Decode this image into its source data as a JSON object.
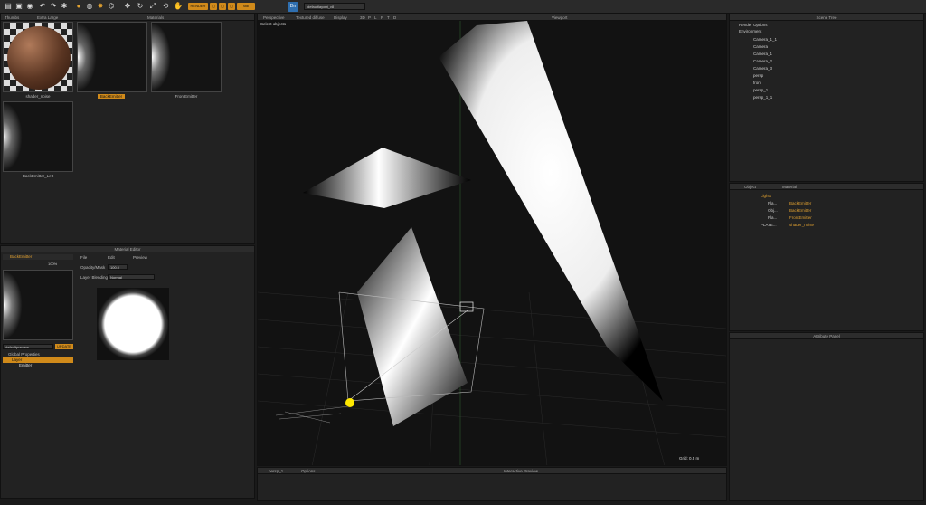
{
  "toolbar": {
    "fx_label": "RENDER",
    "mode_label": "Still",
    "app_badge": "Dn",
    "layout_value": "defaultlayout_v8",
    "icons": [
      "new-file-icon",
      "open-icon",
      "sphere-icon",
      "undo-icon",
      "redo-icon",
      "settings-icon",
      "render-icon",
      "material-icon",
      "light-icon",
      "camera-icon",
      "move-icon",
      "rotate-icon",
      "scale-icon",
      "orbit-icon",
      "pan-icon"
    ]
  },
  "thumbnails_panel": {
    "tabs": [
      "Thumbs",
      "Extra Large"
    ],
    "header": "Materials",
    "items": [
      {
        "label": "shader_noise",
        "selected": false
      },
      {
        "label": "BackEmitter",
        "selected": true
      },
      {
        "label": "FrontEmitter",
        "selected": false
      },
      {
        "label": "BackEmitter_Left",
        "selected": false
      }
    ]
  },
  "viewport": {
    "title": "Viewport",
    "tabs": [
      "Perspective",
      "Textured diffuse",
      "Display",
      "3D",
      "P",
      "L",
      "R",
      "T",
      "D"
    ],
    "hint": "Select objects",
    "grid_label": "Grid: 0.5 m",
    "bottom_tabs": [
      "persp_1",
      "Options"
    ],
    "interactive_title": "Interactive Preview"
  },
  "scene_tree": {
    "title": "Scene Tree",
    "items": [
      {
        "label": "Render Options",
        "type": "options",
        "indent": 0
      },
      {
        "label": "Environment",
        "type": "env",
        "indent": 0
      },
      {
        "label": "Camera_1_1",
        "type": "camera",
        "indent": 1
      },
      {
        "label": "Camera",
        "type": "camera",
        "indent": 1
      },
      {
        "label": "Camera_1",
        "type": "camera",
        "indent": 1
      },
      {
        "label": "Camera_2",
        "type": "camera",
        "indent": 1
      },
      {
        "label": "Camera_3",
        "type": "camera",
        "indent": 1
      },
      {
        "label": "persp",
        "type": "camera",
        "indent": 1
      },
      {
        "label": "front",
        "type": "camera",
        "indent": 1
      },
      {
        "label": "persp_1",
        "type": "camera",
        "indent": 1
      },
      {
        "label": "persp_1_1",
        "type": "camera",
        "indent": 1
      }
    ]
  },
  "object_panel": {
    "headers": [
      "Object",
      "Material"
    ],
    "rows": [
      {
        "object": "Lights",
        "material": "",
        "kind": "group"
      },
      {
        "object": "Pla...",
        "material": "BackEmitter",
        "kind": "light"
      },
      {
        "object": "Obj...",
        "material": "BackEmitter",
        "kind": "light"
      },
      {
        "object": "Pla...",
        "material": "FrontEmitter",
        "kind": "light"
      },
      {
        "object": "PLATE...",
        "material": "shader_noise",
        "kind": "mesh"
      }
    ]
  },
  "attribute_panel": {
    "title": "Attribute Panel"
  },
  "material_editor": {
    "title": "Material Editor",
    "material_name": "BackEmitter",
    "zoom": "100%",
    "menu": [
      "File",
      "Edit",
      "Preview"
    ],
    "opacity_label": "Opacity/Mask",
    "opacity_value": "100.0",
    "blending_label": "Layer Blending",
    "blending_value": "Normal",
    "preset_value": "defaultpreview",
    "update_label": "UPDATE",
    "layers": [
      {
        "label": "Global Properties",
        "level": 0
      },
      {
        "label": "Layer",
        "level": 0,
        "selected": true
      },
      {
        "label": "Emitter",
        "level": 1
      }
    ]
  },
  "colors": {
    "accent": "#d08a1a",
    "panel": "#222222",
    "header": "#2c2c2c"
  }
}
